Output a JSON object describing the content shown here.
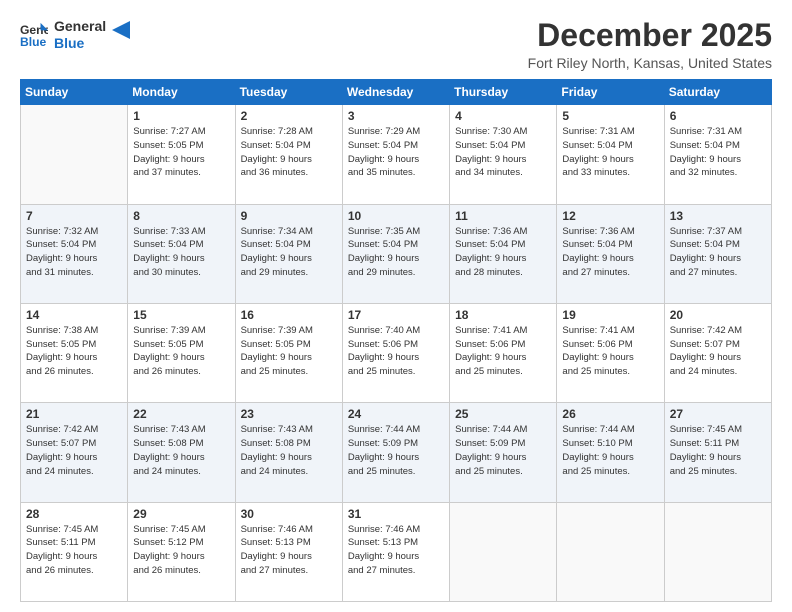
{
  "header": {
    "logo_line1": "General",
    "logo_line2": "Blue",
    "month_title": "December 2025",
    "location": "Fort Riley North, Kansas, United States"
  },
  "weekdays": [
    "Sunday",
    "Monday",
    "Tuesday",
    "Wednesday",
    "Thursday",
    "Friday",
    "Saturday"
  ],
  "weeks": [
    [
      {
        "day": "",
        "info": ""
      },
      {
        "day": "1",
        "info": "Sunrise: 7:27 AM\nSunset: 5:05 PM\nDaylight: 9 hours\nand 37 minutes."
      },
      {
        "day": "2",
        "info": "Sunrise: 7:28 AM\nSunset: 5:04 PM\nDaylight: 9 hours\nand 36 minutes."
      },
      {
        "day": "3",
        "info": "Sunrise: 7:29 AM\nSunset: 5:04 PM\nDaylight: 9 hours\nand 35 minutes."
      },
      {
        "day": "4",
        "info": "Sunrise: 7:30 AM\nSunset: 5:04 PM\nDaylight: 9 hours\nand 34 minutes."
      },
      {
        "day": "5",
        "info": "Sunrise: 7:31 AM\nSunset: 5:04 PM\nDaylight: 9 hours\nand 33 minutes."
      },
      {
        "day": "6",
        "info": "Sunrise: 7:31 AM\nSunset: 5:04 PM\nDaylight: 9 hours\nand 32 minutes."
      }
    ],
    [
      {
        "day": "7",
        "info": "Sunrise: 7:32 AM\nSunset: 5:04 PM\nDaylight: 9 hours\nand 31 minutes."
      },
      {
        "day": "8",
        "info": "Sunrise: 7:33 AM\nSunset: 5:04 PM\nDaylight: 9 hours\nand 30 minutes."
      },
      {
        "day": "9",
        "info": "Sunrise: 7:34 AM\nSunset: 5:04 PM\nDaylight: 9 hours\nand 29 minutes."
      },
      {
        "day": "10",
        "info": "Sunrise: 7:35 AM\nSunset: 5:04 PM\nDaylight: 9 hours\nand 29 minutes."
      },
      {
        "day": "11",
        "info": "Sunrise: 7:36 AM\nSunset: 5:04 PM\nDaylight: 9 hours\nand 28 minutes."
      },
      {
        "day": "12",
        "info": "Sunrise: 7:36 AM\nSunset: 5:04 PM\nDaylight: 9 hours\nand 27 minutes."
      },
      {
        "day": "13",
        "info": "Sunrise: 7:37 AM\nSunset: 5:04 PM\nDaylight: 9 hours\nand 27 minutes."
      }
    ],
    [
      {
        "day": "14",
        "info": "Sunrise: 7:38 AM\nSunset: 5:05 PM\nDaylight: 9 hours\nand 26 minutes."
      },
      {
        "day": "15",
        "info": "Sunrise: 7:39 AM\nSunset: 5:05 PM\nDaylight: 9 hours\nand 26 minutes."
      },
      {
        "day": "16",
        "info": "Sunrise: 7:39 AM\nSunset: 5:05 PM\nDaylight: 9 hours\nand 25 minutes."
      },
      {
        "day": "17",
        "info": "Sunrise: 7:40 AM\nSunset: 5:06 PM\nDaylight: 9 hours\nand 25 minutes."
      },
      {
        "day": "18",
        "info": "Sunrise: 7:41 AM\nSunset: 5:06 PM\nDaylight: 9 hours\nand 25 minutes."
      },
      {
        "day": "19",
        "info": "Sunrise: 7:41 AM\nSunset: 5:06 PM\nDaylight: 9 hours\nand 25 minutes."
      },
      {
        "day": "20",
        "info": "Sunrise: 7:42 AM\nSunset: 5:07 PM\nDaylight: 9 hours\nand 24 minutes."
      }
    ],
    [
      {
        "day": "21",
        "info": "Sunrise: 7:42 AM\nSunset: 5:07 PM\nDaylight: 9 hours\nand 24 minutes."
      },
      {
        "day": "22",
        "info": "Sunrise: 7:43 AM\nSunset: 5:08 PM\nDaylight: 9 hours\nand 24 minutes."
      },
      {
        "day": "23",
        "info": "Sunrise: 7:43 AM\nSunset: 5:08 PM\nDaylight: 9 hours\nand 24 minutes."
      },
      {
        "day": "24",
        "info": "Sunrise: 7:44 AM\nSunset: 5:09 PM\nDaylight: 9 hours\nand 25 minutes."
      },
      {
        "day": "25",
        "info": "Sunrise: 7:44 AM\nSunset: 5:09 PM\nDaylight: 9 hours\nand 25 minutes."
      },
      {
        "day": "26",
        "info": "Sunrise: 7:44 AM\nSunset: 5:10 PM\nDaylight: 9 hours\nand 25 minutes."
      },
      {
        "day": "27",
        "info": "Sunrise: 7:45 AM\nSunset: 5:11 PM\nDaylight: 9 hours\nand 25 minutes."
      }
    ],
    [
      {
        "day": "28",
        "info": "Sunrise: 7:45 AM\nSunset: 5:11 PM\nDaylight: 9 hours\nand 26 minutes."
      },
      {
        "day": "29",
        "info": "Sunrise: 7:45 AM\nSunset: 5:12 PM\nDaylight: 9 hours\nand 26 minutes."
      },
      {
        "day": "30",
        "info": "Sunrise: 7:46 AM\nSunset: 5:13 PM\nDaylight: 9 hours\nand 27 minutes."
      },
      {
        "day": "31",
        "info": "Sunrise: 7:46 AM\nSunset: 5:13 PM\nDaylight: 9 hours\nand 27 minutes."
      },
      {
        "day": "",
        "info": ""
      },
      {
        "day": "",
        "info": ""
      },
      {
        "day": "",
        "info": ""
      }
    ]
  ]
}
